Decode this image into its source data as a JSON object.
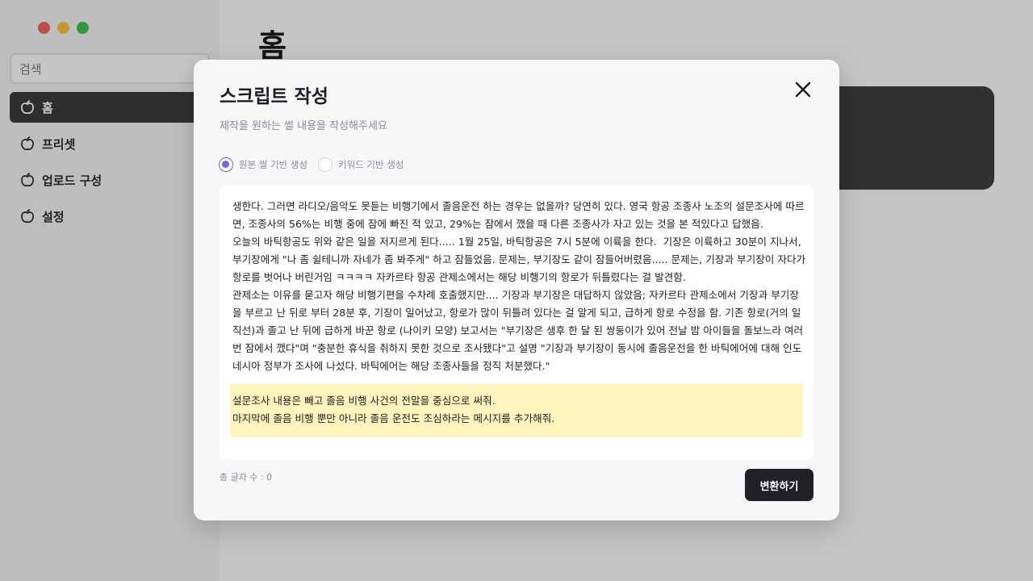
{
  "sidebar": {
    "search_placeholder": "검색",
    "items": [
      {
        "label": "홈",
        "icon": "apple-icon",
        "active": true
      },
      {
        "label": "프리셋",
        "icon": "apple-icon",
        "active": false
      },
      {
        "label": "업로드 구성",
        "icon": "apple-icon",
        "active": false
      },
      {
        "label": "설정",
        "icon": "apple-icon",
        "active": false
      }
    ]
  },
  "main": {
    "title": "홈"
  },
  "modal": {
    "title": "스크립트 작성",
    "subtitle": "제작을 원하는 썰 내용을 작성해주세요",
    "radio_options": [
      {
        "label": "원본 썰 기반 생성",
        "checked": true
      },
      {
        "label": "키워드 기반 생성",
        "checked": false
      }
    ],
    "body_text": "생한다. 그러면 라디오/음악도 못듣는 비행기에서 졸음운전 하는 경우는 없을까? 당연히 있다. 영국 항공 조종사 노조의 설문조사에 따르면, 조종사의 56%는 비행 중에 잠에 빠진 적 있고, 29%는 잠에서 깼을 때 다른 조종사가 자고 있는 것을 본 적있다고 답했음.\n오늘의 바틱항공도 위와 같은 일을 저지르게 된다..... 1월 25일, 바틱항공은 7시 5분에 이륙을 한다.  기장은 이륙하고 30분이 지나서, 부기장에게 \"나 좀 쉴테니까 자네가 좀 봐주게\" 하고 잠들었음. 문제는, 부기장도 같이 잠들어버렸음..... 문제는, 기장과 부기장이 자다가 항로를 벗어나 버린거임 ㅋㅋㅋㅋ 자카르타 항공 관제소에서는 해당 비행기의 항로가 뒤틀렸다는 걸 발견함.\n관제소는 이유를 묻고자 해당 비행기편을 수차례 호출했지만.... 기장과 부기장은 대답하지 않았음; 자카르타 관제소에서 기장과 부기장을 부르고 난 뒤로 부터 28분 후, 기장이 일어났고, 항로가 많이 뒤틀려 있다는 걸 알게 되고, 급하게 항로 수정을 함. 기존 항로(거의 일직선)과 졸고 난 뒤에 급하게 바꾼 항로 (나이키 모양) 보고서는 \"부기장은 생후 한 달 된 쌍둥이가 있어 전날 밤 아이들을 돌보느라 여러 번 잠에서 깼다\"며 \"충분한 휴식을 취하지 못한 것으로 조사됐다\"고 설명 \"기장과 부기장이 동시에 졸음운전을 한 바틱에어에 대해 인도네시아 정부가 조사에 나섰다. 바틱에어는 해당 조종사들을 정직 처분했다.\"",
    "highlight_text": "설문조사 내용은 빼고 졸음 비행 사건의 전말을 중심으로 써줘.\n마지막에 졸음 비행 뿐만 아니라 졸음 운전도 조심하라는 메시지를 추가해줘.",
    "char_count": "총 글자 수 : 0",
    "convert_label": "변환하기"
  },
  "colors": {
    "accent": "#7a64e6",
    "highlight": "#fef4bd",
    "button_dark": "#1f2127"
  }
}
